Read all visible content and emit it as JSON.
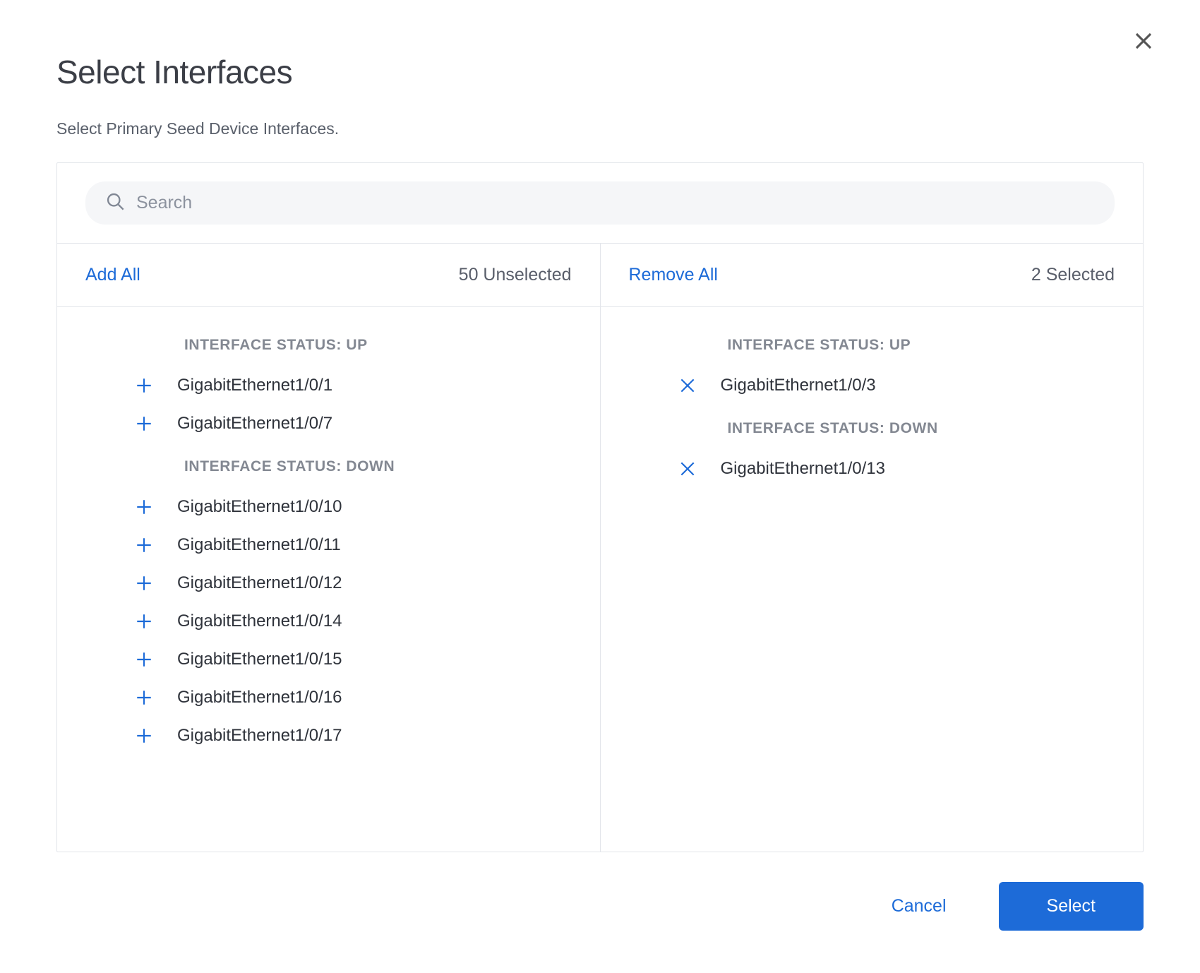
{
  "header": {
    "title": "Select Interfaces",
    "subtitle": "Select Primary Seed Device Interfaces."
  },
  "search": {
    "placeholder": "Search",
    "value": ""
  },
  "left": {
    "action_label": "Add All",
    "count_text": "50 Unselected",
    "groups": [
      {
        "heading": "INTERFACE STATUS: UP",
        "items": [
          "GigabitEthernet1/0/1",
          "GigabitEthernet1/0/7"
        ]
      },
      {
        "heading": "INTERFACE STATUS: DOWN",
        "items": [
          "GigabitEthernet1/0/10",
          "GigabitEthernet1/0/11",
          "GigabitEthernet1/0/12",
          "GigabitEthernet1/0/14",
          "GigabitEthernet1/0/15",
          "GigabitEthernet1/0/16",
          "GigabitEthernet1/0/17"
        ]
      }
    ]
  },
  "right": {
    "action_label": "Remove All",
    "count_text": "2 Selected",
    "groups": [
      {
        "heading": "INTERFACE STATUS: UP",
        "items": [
          "GigabitEthernet1/0/3"
        ]
      },
      {
        "heading": "INTERFACE STATUS: DOWN",
        "items": [
          "GigabitEthernet1/0/13"
        ]
      }
    ]
  },
  "footer": {
    "cancel_label": "Cancel",
    "select_label": "Select"
  }
}
